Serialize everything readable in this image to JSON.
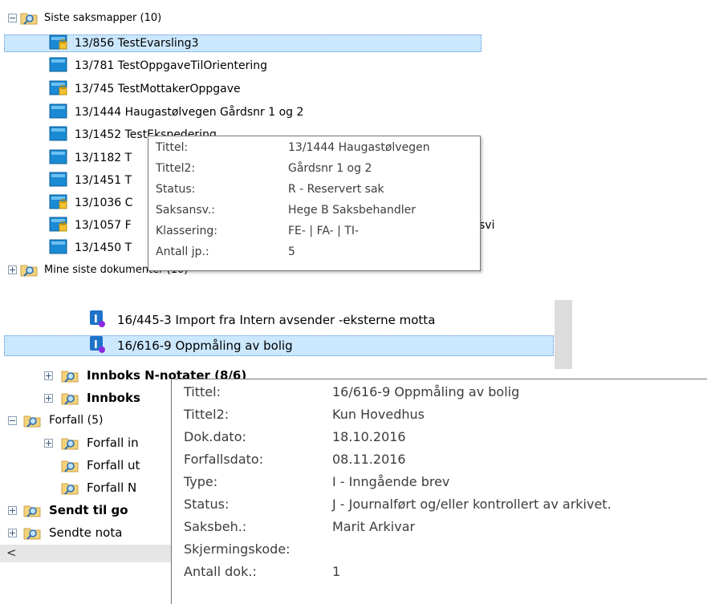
{
  "panel1": {
    "root_label": "Siste saksmapper (10)",
    "items": [
      {
        "label": "13/856 TestEvarsling3"
      },
      {
        "label": "13/781 TestOppgaveTilOrientering"
      },
      {
        "label": "13/745 TestMottakerOppgave"
      },
      {
        "label": "13/1444 Haugastølvegen Gårdsnr 1 og 2"
      },
      {
        "label": "13/1452 TestEkspedering"
      },
      {
        "label": "13/1182 T"
      },
      {
        "label": "13/1451 T"
      },
      {
        "label": "13/1036 C"
      },
      {
        "label": "13/1057 F"
      },
      {
        "label": "13/1450 T"
      }
    ],
    "behind_tip_fragment": "svi",
    "next_root_label": "Mine siste dokumenter (10)",
    "tooltip": {
      "rows": [
        {
          "label": "Tittel:",
          "value": "13/1444 Haugastølvegen"
        },
        {
          "label": "Tittel2:",
          "value": "Gårdsnr 1 og 2"
        },
        {
          "label": "Status:",
          "value": "R - Reservert sak"
        },
        {
          "label": "Saksansv.:",
          "value": "Hege B Saksbehandler"
        },
        {
          "label": "Klassering:",
          "value": "FE- | FA- | TI-"
        },
        {
          "label": "Antall jp.:",
          "value": "5"
        }
      ]
    }
  },
  "panel2": {
    "doc_items": [
      {
        "label": "16/445-3 Import fra Intern avsender -eksterne motta"
      },
      {
        "label": "16/616-9 Oppmåling av bolig"
      }
    ],
    "folders": [
      {
        "label": "Innboks N-notater (8/6)",
        "bold": true
      },
      {
        "label": "Innboks",
        "bold": true
      },
      {
        "label": "Forfall (5)",
        "bold": false
      },
      {
        "label": "Forfall in",
        "bold": false
      },
      {
        "label": "Forfall ut",
        "bold": false
      },
      {
        "label": "Forfall N",
        "bold": false
      },
      {
        "label": "Sendt til go",
        "bold": true
      },
      {
        "label": "Sendte nota",
        "bold": false
      }
    ],
    "scroll_left_glyph": "<",
    "tooltip": {
      "rows": [
        {
          "label": "Tittel:",
          "value": "16/616-9 Oppmåling av bolig"
        },
        {
          "label": "Tittel2:",
          "value": "Kun Hovedhus"
        },
        {
          "label": "Dok.dato:",
          "value": "18.10.2016"
        },
        {
          "label": "Forfallsdato:",
          "value": "08.11.2016"
        },
        {
          "label": "Type:",
          "value": "I - Inngående brev"
        },
        {
          "label": "Status:",
          "value": "J - Journalført og/eller kontrollert av arkivet."
        },
        {
          "label": "Saksbeh.:",
          "value": "Marit Arkivar"
        },
        {
          "label": "Skjermingskode:",
          "value": ""
        },
        {
          "label": "Antall dok.:",
          "value": "1"
        }
      ]
    }
  },
  "colors": {
    "selection": "#cce8ff",
    "case_folder_blue": "#1a8ad4",
    "lock_yellow": "#f2c230",
    "search_folder": "#f3d27a",
    "doc_icon_blue": "#1e73c8",
    "doc_badge_purple": "#8a2be2"
  },
  "icons": {
    "search_folder": "search-folder-icon",
    "case_folder": "case-folder-icon",
    "locked_case_folder": "locked-case-folder-icon",
    "incoming_doc": "incoming-document-icon",
    "expander": "expand-collapse-icon"
  }
}
